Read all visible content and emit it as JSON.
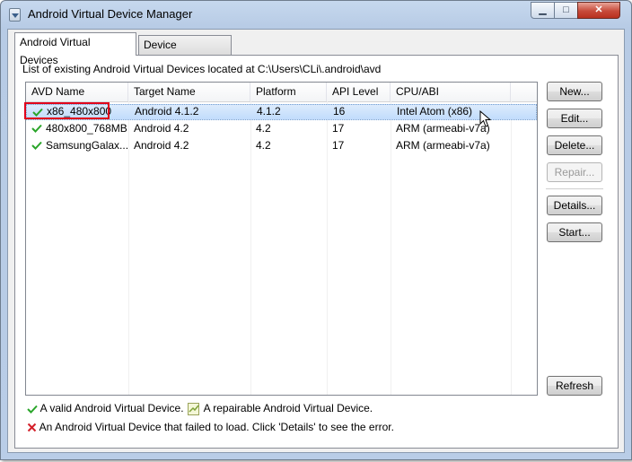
{
  "window": {
    "title": "Android Virtual Device Manager",
    "minimize_glyph": "▁",
    "maximize_glyph": "□",
    "close_glyph": "✕"
  },
  "tabs": [
    {
      "label": "Android Virtual Devices",
      "active": true
    },
    {
      "label": "Device Definitions",
      "active": false
    }
  ],
  "path_label": "List of existing Android Virtual Devices located at C:\\Users\\CLi\\.android\\avd",
  "table": {
    "columns": [
      "AVD Name",
      "Target Name",
      "Platform",
      "API Level",
      "CPU/ABI"
    ],
    "rows": [
      {
        "name": "x86_480x800",
        "target": "Android 4.1.2",
        "platform": "4.1.2",
        "api": "16",
        "cpu": "Intel Atom (x86)",
        "status_icon": "valid-check-icon",
        "selected": true
      },
      {
        "name": "480x800_768MB",
        "target": "Android 4.2",
        "platform": "4.2",
        "api": "17",
        "cpu": "ARM (armeabi-v7a)",
        "status_icon": "valid-check-icon",
        "selected": false
      },
      {
        "name": "SamsungGalax...",
        "target": "Android 4.2",
        "platform": "4.2",
        "api": "17",
        "cpu": "ARM (armeabi-v7a)",
        "status_icon": "valid-check-icon",
        "selected": false
      }
    ]
  },
  "buttons": {
    "new": "New...",
    "edit": "Edit...",
    "delete": "Delete...",
    "repair": "Repair...",
    "details": "Details...",
    "start": "Start...",
    "refresh": "Refresh"
  },
  "legend": {
    "valid": "A valid Android Virtual Device.",
    "repairable": "A repairable Android Virtual Device.",
    "failed": "An Android Virtual Device that failed to load. Click 'Details' to see the error."
  },
  "colors": {
    "valid_check": "#2aa52a",
    "error_x": "#d4202a",
    "highlight_box": "#e0001b",
    "selection": "#c1dcfc"
  }
}
